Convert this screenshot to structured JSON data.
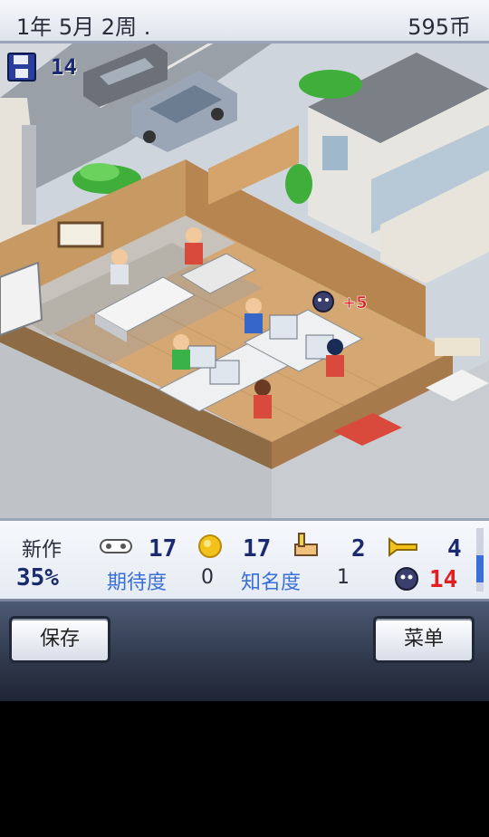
{
  "header": {
    "date": "1年 5月 2周 .",
    "money": "595币"
  },
  "save_counter": {
    "value": "14"
  },
  "scene": {
    "popup_text": "+5"
  },
  "status": {
    "new_game_label": "新作",
    "progress": "35%",
    "fun": "17",
    "creativity": "17",
    "graphics": "2",
    "sound": "4",
    "expectation_label": "期待度",
    "expectation_value": "0",
    "fame_label": "知名度",
    "fame_value": "1",
    "bugs": "14"
  },
  "buttons": {
    "save": "保存",
    "menu": "菜单"
  },
  "colors": {
    "bugs": "#e02020",
    "accent": "#1b2a6e",
    "label_blue": "#3a6fd8"
  }
}
